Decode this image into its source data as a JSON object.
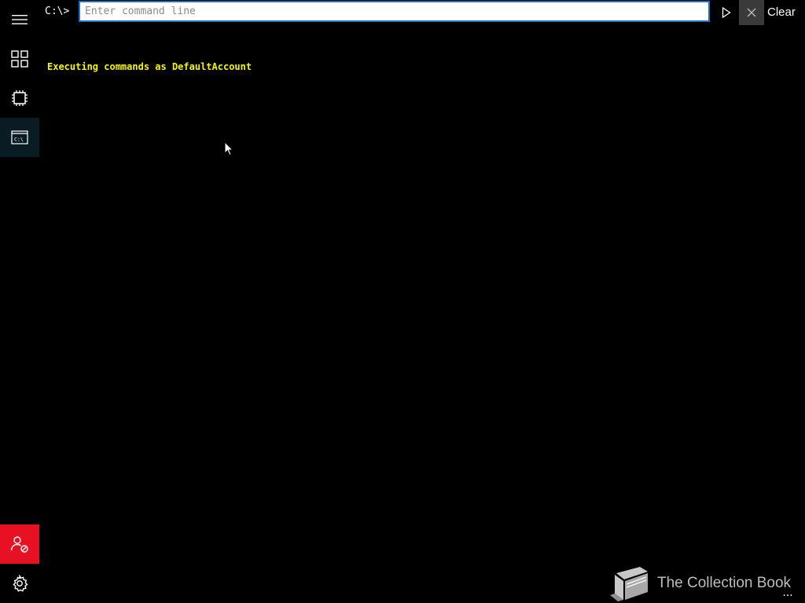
{
  "sidebar": {
    "items": [
      {
        "name": "hamburger-menu",
        "icon": "hamburger-icon"
      },
      {
        "name": "dashboard",
        "icon": "dashboard-grid-icon"
      },
      {
        "name": "processes",
        "icon": "chip-icon"
      },
      {
        "name": "command-prompt",
        "icon": "console-icon",
        "icon_text": "C:\\",
        "active": true
      }
    ],
    "bottom_items": [
      {
        "name": "user-status",
        "icon": "user-blocked-icon"
      },
      {
        "name": "settings",
        "icon": "gear-icon"
      }
    ]
  },
  "command_bar": {
    "prompt": "C:\\>",
    "input_value": "",
    "input_placeholder": "Enter command line",
    "run_icon": "play-icon",
    "close_icon": "close-icon",
    "clear_label": "Clear"
  },
  "output": {
    "lines": [
      "Executing commands as DefaultAccount"
    ]
  },
  "watermark": {
    "icon": "book-icon",
    "text": "The Collection Book"
  },
  "footer": {
    "more_label": "..."
  },
  "colors": {
    "background": "#000000",
    "output_text": "#f5f500",
    "input_border": "#1a73c8",
    "active_nav": "#0b1b24",
    "alert_red": "#e81123",
    "close_bg": "#3a3a3a"
  }
}
